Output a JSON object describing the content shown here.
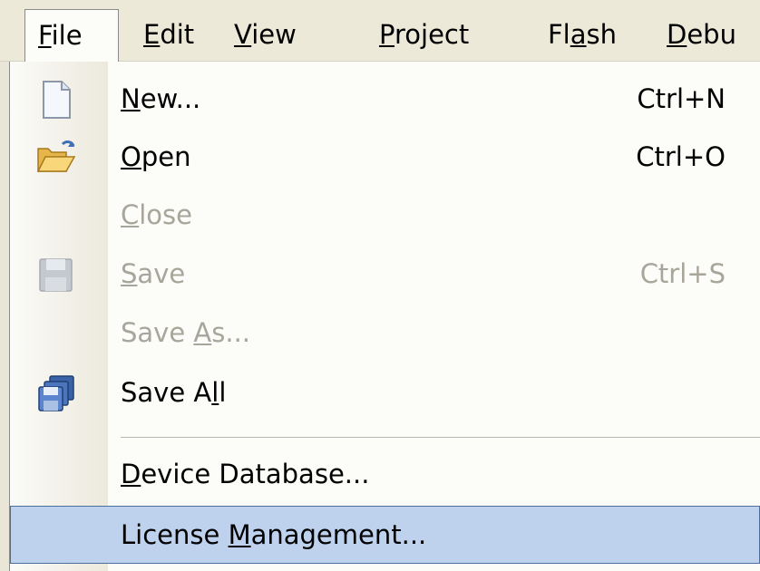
{
  "menubar": {
    "items": [
      {
        "pre": "",
        "key": "F",
        "post": "ile"
      },
      {
        "pre": "",
        "key": "E",
        "post": "dit"
      },
      {
        "pre": "",
        "key": "V",
        "post": "iew"
      },
      {
        "pre": "",
        "key": "P",
        "post": "roject"
      },
      {
        "pre": "Fl",
        "key": "a",
        "post": "sh"
      },
      {
        "pre": "",
        "key": "D",
        "post": "ebu"
      }
    ]
  },
  "file_menu": {
    "items": [
      {
        "pre": "",
        "key": "N",
        "post": "ew...",
        "shortcut": "Ctrl+N",
        "enabled": true,
        "icon": "new-file-icon"
      },
      {
        "pre": "",
        "key": "O",
        "post": "pen",
        "shortcut": "Ctrl+O",
        "enabled": true,
        "icon": "open-folder-icon"
      },
      {
        "pre": "",
        "key": "C",
        "post": "lose",
        "shortcut": "",
        "enabled": false,
        "icon": ""
      },
      {
        "pre": "",
        "key": "S",
        "post": "ave",
        "shortcut": "Ctrl+S",
        "enabled": false,
        "icon": "save-disk-icon"
      },
      {
        "pre": "Save ",
        "key": "A",
        "post": "s...",
        "shortcut": "",
        "enabled": false,
        "icon": ""
      },
      {
        "pre": "Save A",
        "key": "l",
        "post": "l",
        "shortcut": "",
        "enabled": true,
        "icon": "save-all-icon"
      },
      {
        "pre": "",
        "key": "D",
        "post": "evice Database...",
        "shortcut": "",
        "enabled": true,
        "icon": ""
      },
      {
        "pre": "License ",
        "key": "M",
        "post": "anagement...",
        "shortcut": "",
        "enabled": true,
        "highlighted": true,
        "icon": ""
      }
    ]
  },
  "colors": {
    "highlight_fill": "#bed2ee",
    "highlight_border": "#4b6f9f",
    "disabled_text": "#a8a59a"
  }
}
